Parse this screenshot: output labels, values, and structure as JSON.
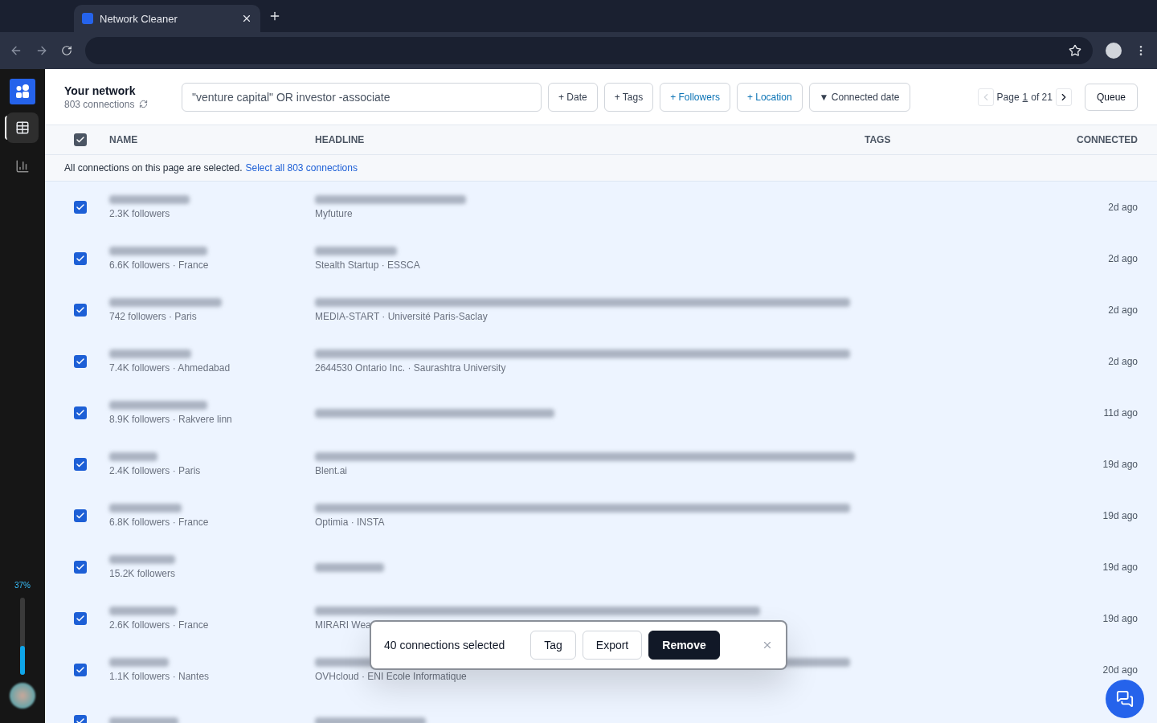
{
  "browser": {
    "tab_title": "Network Cleaner"
  },
  "sidebar": {
    "items": [
      {
        "kind": "table",
        "selected": true
      },
      {
        "kind": "chart",
        "selected": false
      }
    ],
    "usage": {
      "reading": "37%",
      "level": 0.37
    }
  },
  "header": {
    "title": "Your network",
    "subtitle": "803 connections",
    "search": {
      "value": "\"venture capital\" OR investor -associate"
    },
    "filters": [
      {
        "label": "+ Date",
        "active": false
      },
      {
        "label": "+ Tags",
        "active": false
      },
      {
        "label": "+ Followers",
        "active": true
      },
      {
        "label": "+ Location",
        "active": true
      },
      {
        "label": "▼ Connected date",
        "active": false
      }
    ],
    "pager": {
      "label": "Page",
      "current": "1",
      "total": "of 21",
      "prev_disabled": true
    },
    "queue": "Queue"
  },
  "table": {
    "select_all": true,
    "columns": [
      "NAME",
      "HEADLINE",
      "TAGS",
      "CONNECTED"
    ],
    "banner": {
      "text": "All connections on this page are selected.",
      "link": "Select all 803 connections"
    },
    "rows": [
      {
        "selected": true,
        "meta": "2.3K followers",
        "headline_sub": "Myfuture",
        "connected": "2d ago"
      },
      {
        "selected": true,
        "meta": "6.6K followers · France",
        "headline_sub": "Stealth Startup · ESSCA",
        "connected": "2d ago"
      },
      {
        "selected": true,
        "meta": "742 followers · Paris",
        "headline_sub": "MEDIA-START · Université Paris-Saclay",
        "connected": "2d ago"
      },
      {
        "selected": true,
        "meta": "7.4K followers · Ahmedabad",
        "headline_sub": "2644530 Ontario Inc. · Saurashtra University",
        "connected": "2d ago"
      },
      {
        "selected": true,
        "meta": "8.9K followers · Rakvere linn",
        "connected": "11d ago"
      },
      {
        "selected": true,
        "meta": "2.4K followers · Paris",
        "headline_sub": "Blent.ai",
        "connected": "19d ago"
      },
      {
        "selected": true,
        "meta": "6.8K followers · France",
        "headline_sub": "Optimia · INSTA",
        "connected": "19d ago"
      },
      {
        "selected": true,
        "meta": "15.2K followers",
        "connected": "19d ago"
      },
      {
        "selected": true,
        "meta": "2.6K followers · France",
        "headline_sub": "MIRARI Wea",
        "connected": "19d ago"
      },
      {
        "selected": true,
        "meta": "1.1K followers · Nantes",
        "headline_sub": "OVHcloud · ENI Ecole Informatique",
        "connected": "20d ago"
      },
      {
        "selected": true
      }
    ]
  },
  "selection_bar": {
    "text": "40 connections selected",
    "actions": [
      {
        "label": "Tag",
        "kind": "secondary"
      },
      {
        "label": "Export",
        "kind": "secondary"
      },
      {
        "label": "Remove",
        "kind": "primary"
      }
    ]
  }
}
